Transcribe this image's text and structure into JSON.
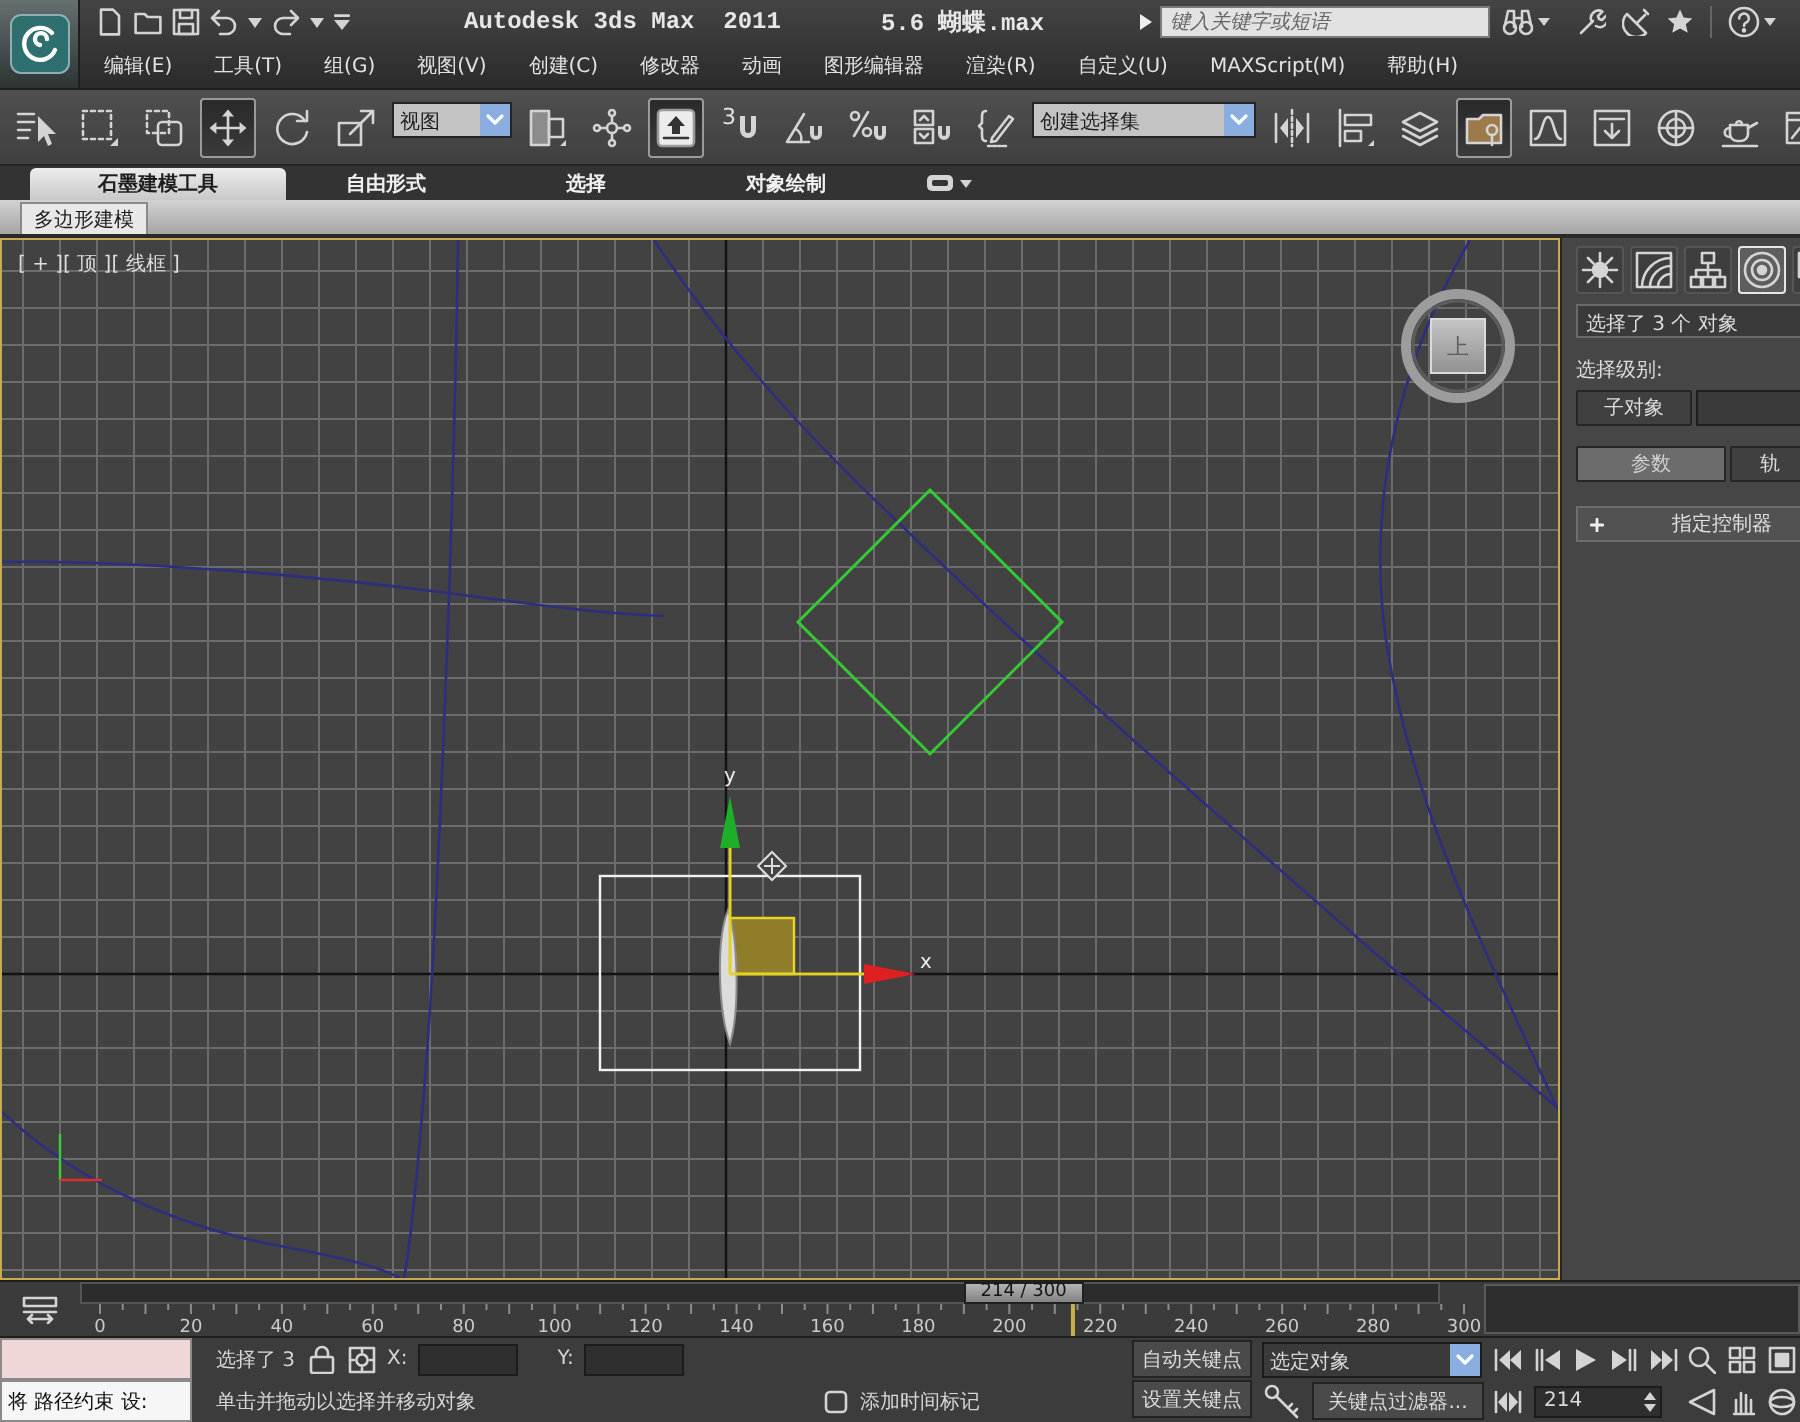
{
  "title": {
    "app": "Autodesk 3ds Max  2011",
    "file": "5.6 蝴蝶.max"
  },
  "search": {
    "placeholder": "键入关键字或短语"
  },
  "menu": [
    "编辑(E)",
    "工具(T)",
    "组(G)",
    "视图(V)",
    "创建(C)",
    "修改器",
    "动画",
    "图形编辑器",
    "渲染(R)",
    "自定义(U)",
    "MAXScript(M)",
    "帮助(H)"
  ],
  "toolbar": [
    {
      "kind": "select-list",
      "active": false
    },
    {
      "kind": "rect-select",
      "active": false
    },
    {
      "kind": "window-crossing",
      "active": false
    },
    {
      "kind": "move",
      "active": true
    },
    {
      "kind": "rotate",
      "active": false
    },
    {
      "kind": "scale",
      "active": false
    },
    {
      "kind": "dropdown",
      "value": "视图"
    },
    {
      "kind": "pivot",
      "active": false
    },
    {
      "kind": "manipulate",
      "active": false
    },
    {
      "kind": "shortcut",
      "active": true
    },
    {
      "kind": "snap",
      "label": "3",
      "active": false
    },
    {
      "kind": "angle-snap",
      "active": false
    },
    {
      "kind": "percent-snap",
      "active": false
    },
    {
      "kind": "spinner-snap",
      "active": false
    },
    {
      "kind": "named-sets",
      "active": false
    },
    {
      "kind": "dropdown",
      "value": "创建选择集"
    },
    {
      "kind": "mirror",
      "active": false
    },
    {
      "kind": "align",
      "active": false
    },
    {
      "kind": "layers",
      "active": false
    },
    {
      "kind": "graphite",
      "active": true
    },
    {
      "kind": "curve-editor",
      "active": false
    },
    {
      "kind": "schematic",
      "active": false
    },
    {
      "kind": "material",
      "active": false
    },
    {
      "kind": "render-setup",
      "active": false
    },
    {
      "kind": "render-frame",
      "active": false
    }
  ],
  "ribbon": {
    "tabs": [
      {
        "label": "石墨建模工具",
        "selected": true
      },
      {
        "label": "自由形式",
        "selected": false
      },
      {
        "label": "选择",
        "selected": false
      },
      {
        "label": "对象绘制",
        "selected": false
      }
    ],
    "panels": [
      {
        "label": "多边形建模",
        "selected": true
      }
    ]
  },
  "viewport": {
    "label": "[ + ][ 顶 ][ 线框 ]",
    "active": true,
    "viewcube_face": "上",
    "gizmo": {
      "x_label": "x",
      "y_label": "y"
    }
  },
  "command_panel": {
    "tabs": [
      {
        "kind": "create",
        "selected": false
      },
      {
        "kind": "modify",
        "selected": false
      },
      {
        "kind": "hierarchy",
        "selected": false
      },
      {
        "kind": "motion",
        "selected": true
      },
      {
        "kind": "display",
        "selected": false
      }
    ],
    "selection": "选择了 3 个 对象",
    "level_label": "选择级别:",
    "sub_object": "子对象",
    "modes": [
      {
        "label": "参数",
        "selected": true
      },
      {
        "label": "轨",
        "selected": false
      }
    ],
    "rollout": {
      "expanded": false,
      "title": "指定控制器"
    }
  },
  "timeline": {
    "slider": {
      "label": "214 / 300",
      "level": 0.7133
    },
    "ticks": [
      "0",
      "20",
      "40",
      "60",
      "80",
      "100",
      "120",
      "140",
      "160",
      "180",
      "200",
      "220",
      "240",
      "260",
      "280",
      "300"
    ]
  },
  "status_bar": {
    "listener": "将 路径约束 设:",
    "selection": "选择了 3",
    "coords": [
      "X:",
      "Y:"
    ],
    "prompt": "单击并拖动以选择并移动对象",
    "time_tag": "添加时间标记",
    "auto_key": "自动关键点",
    "key_set": "选定对象",
    "set_key": "设置关键点",
    "key_filters": "关键点过滤器...",
    "frame": "214"
  }
}
